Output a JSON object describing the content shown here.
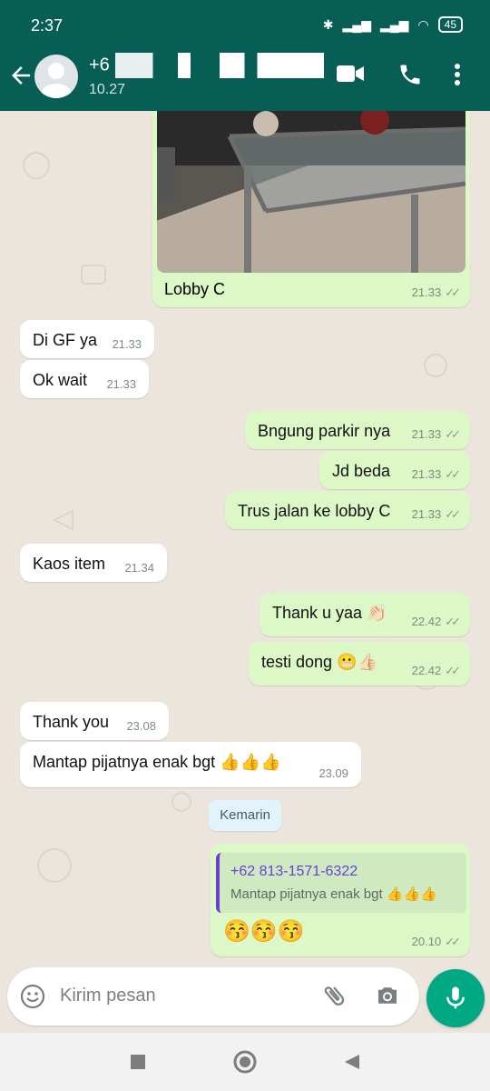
{
  "status_bar": {
    "time": "2:37",
    "battery": "45"
  },
  "header": {
    "name_visible": "+6",
    "subtitle": "10.27"
  },
  "photo_message": {
    "caption": "Lobby C",
    "time": "21.33"
  },
  "messages": [
    {
      "dir": "in",
      "text": "Di GF ya",
      "time": "21.33"
    },
    {
      "dir": "in",
      "text": "Ok wait",
      "time": "21.33"
    },
    {
      "dir": "out",
      "text": "Bngung parkir nya",
      "time": "21.33"
    },
    {
      "dir": "out",
      "text": "Jd beda",
      "time": "21.33"
    },
    {
      "dir": "out",
      "text": "Trus jalan ke lobby C",
      "time": "21.33"
    },
    {
      "dir": "in",
      "text": "Kaos item",
      "time": "21.34"
    },
    {
      "dir": "out",
      "text": "Thank u yaa 👏🏻",
      "time": "22.42"
    },
    {
      "dir": "out",
      "text": "testi dong 😬👍🏻",
      "time": "22.42"
    },
    {
      "dir": "in",
      "text": "Thank you",
      "time": "23.08"
    },
    {
      "dir": "in",
      "text": "Mantap pijatnya enak bgt 👍👍👍",
      "time": "23.09"
    }
  ],
  "date_divider": "Kemarin",
  "reply_message": {
    "quoted_name": "+62 813-1571-6322",
    "quoted_text": "Mantap pijatnya enak bgt 👍👍👍",
    "text": "😚😚😚",
    "time": "20.10"
  },
  "input": {
    "placeholder": "Kirim pesan"
  },
  "colors": {
    "header": "#075e54",
    "outgoing": "#dcf8c6",
    "incoming": "#ffffff",
    "accent": "#00a884"
  },
  "icons": [
    "back-arrow-icon",
    "video-call-icon",
    "phone-icon",
    "more-icon",
    "emoji-icon",
    "attach-icon",
    "camera-icon",
    "mic-icon"
  ]
}
